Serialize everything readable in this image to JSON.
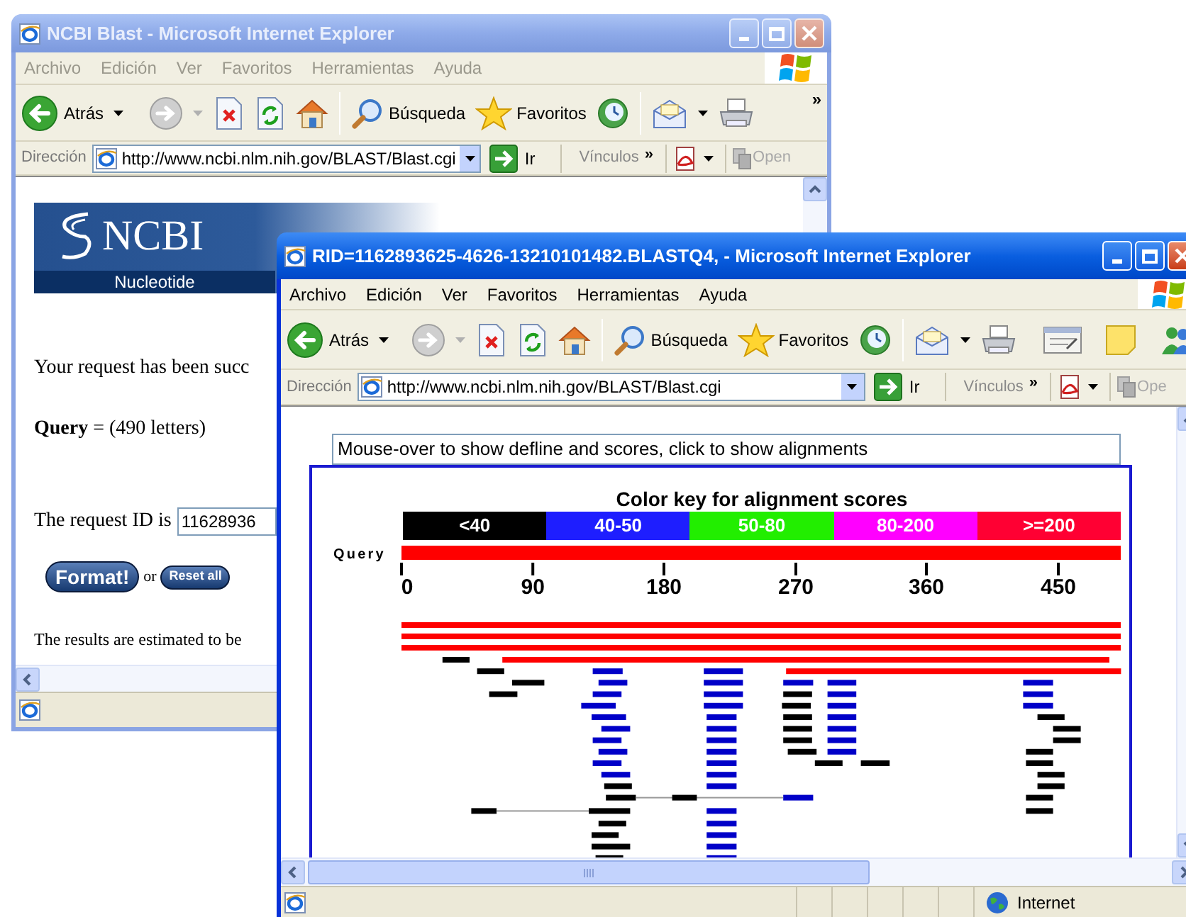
{
  "back_window": {
    "title": "NCBI Blast - Microsoft Internet Explorer",
    "active": false,
    "menu": [
      "Archivo",
      "Edición",
      "Ver",
      "Favoritos",
      "Herramientas",
      "Ayuda"
    ],
    "toolbar": {
      "back": "Atrás",
      "search": "Búsqueda",
      "favorites": "Favoritos",
      "more": "»"
    },
    "address_bar": {
      "label": "Dirección",
      "url": "http://www.ncbi.nlm.nih.gov/BLAST/Blast.cgi",
      "go": "Ir",
      "links": "Vínculos",
      "links_more": "»",
      "open": "Open"
    },
    "page": {
      "logo": "NCBI",
      "logo_subtitle": "Nucleotide",
      "message": "Your request has been succ",
      "query": "**Query** = (490 letters)",
      "request_id_label": "The request ID is",
      "request_id": "11628936",
      "format_button": "Format!",
      "or": "or",
      "reset_button": "Reset all",
      "estimate": "The results are estimated to be"
    }
  },
  "front_window": {
    "title": "RID=1162893625-4626-13210101482.BLASTQ4, - Microsoft Internet Explorer",
    "active": true,
    "menu": [
      "Archivo",
      "Edición",
      "Ver",
      "Favoritos",
      "Herramientas",
      "Ayuda"
    ],
    "toolbar": {
      "back": "Atrás",
      "search": "Búsqueda",
      "favorites": "Favoritos"
    },
    "address_bar": {
      "label": "Dirección",
      "url": "http://www.ncbi.nlm.nih.gov/BLAST/Blast.cgi",
      "go": "Ir",
      "links": "Vínculos",
      "links_more": "»",
      "open": "Ope"
    },
    "page": {
      "hint": "Mouse-over to show defline and scores, click to show alignments",
      "color_key": {
        "title": "Color key for alignment scores",
        "items": [
          {
            "label": "<40",
            "color": "#000000"
          },
          {
            "label": "40-50",
            "color": "#1e1eff"
          },
          {
            "label": "50-80",
            "color": "#22ee00"
          },
          {
            "label": "80-200",
            "color": "#ff00ff"
          },
          {
            "label": ">=200",
            "color": "#ff0033"
          }
        ]
      },
      "query_label": "Query",
      "ticks": [
        "0",
        "90",
        "180",
        "270",
        "360",
        "450"
      ]
    },
    "status_bar": {
      "zone": "Internet"
    }
  }
}
